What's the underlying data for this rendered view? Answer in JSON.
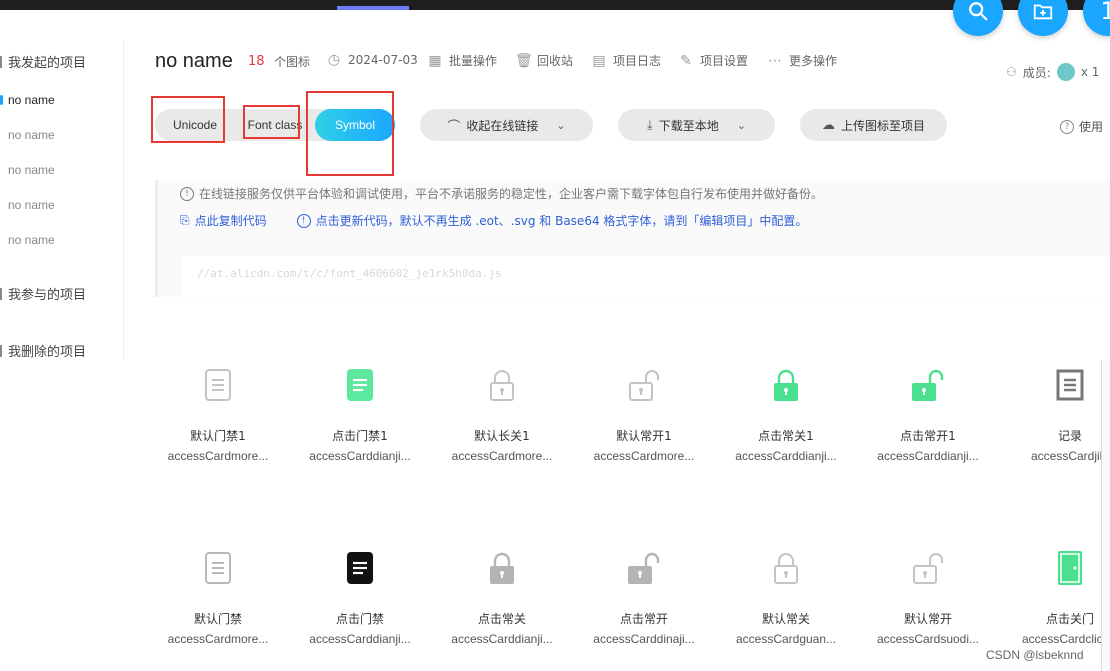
{
  "top_actions": [
    "search-icon",
    "new-folder-icon",
    "1"
  ],
  "sidebar": {
    "started_projects_label": "我发起的项目",
    "items": [
      "no name",
      "no name",
      "no name",
      "no name",
      "no name"
    ],
    "joined_projects_label": "我参与的项目",
    "deleted_projects_label": "我删除的项目"
  },
  "header": {
    "title": "no name",
    "icon_count": "18",
    "icon_count_label": "个图标",
    "date": "2024-07-03",
    "batch_ops": "批量操作",
    "recycle_bin": "回收站",
    "project_log": "项目日志",
    "project_settings": "项目设置",
    "more_ops": "更多操作",
    "members_label": "成员:",
    "members_count": "x 1"
  },
  "tabs": {
    "unicode": "Unicode",
    "font_class": "Font class",
    "symbol": "Symbol",
    "active": "Symbol"
  },
  "toolbar": {
    "collapse_link": "收起在线链接",
    "download_local": "下载至本地",
    "upload_icons": "上传图标至项目",
    "help": "使用"
  },
  "notice": {
    "warning": "在线链接服务仅供平台体验和调试使用，平台不承诺服务的稳定性，企业客户需下载字体包自行发布使用并做好备份。",
    "copy_code": "点此复制代码",
    "update_code": "点击更新代码，默认不再生成 .eot、.svg 和 Base64 格式字体，请到「编辑项目」中配置。",
    "code_url": "//at.alicdn.com/t/c/font_4606602_je1rk5h0da.js"
  },
  "icons": [
    {
      "name": "默认门禁1",
      "code": "accessCardmore...",
      "glyph": "doc-outline-icon",
      "color": "#c4c4c4"
    },
    {
      "name": "点击门禁1",
      "code": "accessCarddianji...",
      "glyph": "doc-filled-icon",
      "color": "#5de8a0"
    },
    {
      "name": "默认长关1",
      "code": "accessCardmore...",
      "glyph": "lock-closed-outline-icon",
      "color": "#c4c4c4"
    },
    {
      "name": "默认常开1",
      "code": "accessCardmore...",
      "glyph": "lock-open-outline-icon",
      "color": "#c4c4c4"
    },
    {
      "name": "点击常关1",
      "code": "accessCarddianji...",
      "glyph": "lock-closed-filled-icon",
      "color": "#4be08f"
    },
    {
      "name": "点击常开1",
      "code": "accessCarddianji...",
      "glyph": "lock-open-filled-icon",
      "color": "#4be08f"
    },
    {
      "name": "记录",
      "code": "accessCardjilu",
      "glyph": "record-icon",
      "color": "#777777"
    },
    {
      "name": "默认门禁",
      "code": "accessCardmore...",
      "glyph": "doc-outline-icon",
      "color": "#b9b9b9"
    },
    {
      "name": "点击门禁",
      "code": "accessCarddianji...",
      "glyph": "doc-filled-icon",
      "color": "#111111"
    },
    {
      "name": "点击常关",
      "code": "accessCarddianji...",
      "glyph": "lock-closed-filled-icon",
      "color": "#b4b4b4"
    },
    {
      "name": "点击常开",
      "code": "accessCarddinaji...",
      "glyph": "lock-open-filled-icon",
      "color": "#b4b4b4"
    },
    {
      "name": "默认常关",
      "code": "accessCardguan...",
      "glyph": "lock-closed-outline-icon",
      "color": "#c4c4c4"
    },
    {
      "name": "默认常开",
      "code": "accessCardsuodi...",
      "glyph": "lock-open-outline-icon",
      "color": "#c4c4c4"
    },
    {
      "name": "点击关门",
      "code": "accessCardclickG",
      "glyph": "door-icon",
      "color": "#4be08f"
    }
  ],
  "watermark": "CSDN @lsbeknnd"
}
